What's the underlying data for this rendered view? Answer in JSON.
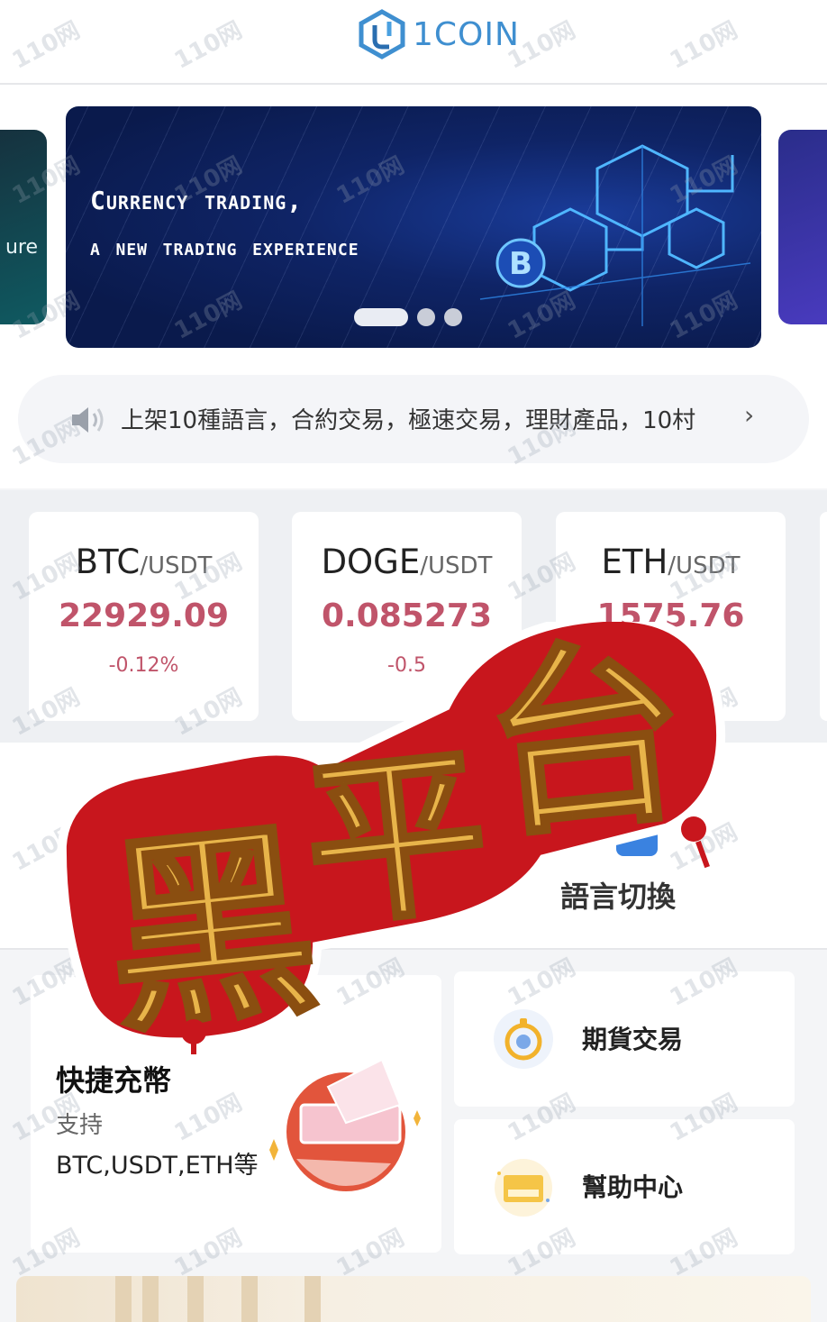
{
  "header": {
    "logo_text": "1COIN"
  },
  "banner": {
    "line1": "Currency trading,",
    "line2": "a new trading experience",
    "side_left_text": "ure",
    "coin_symbol": "B",
    "slide_count": 3,
    "active_slide": 1
  },
  "notice": {
    "icon": "speaker-icon",
    "text": "上架10種語言，合約交易，極速交易，理財產品，10村",
    "chevron": "›"
  },
  "tickers": [
    {
      "base": "BTC",
      "quote": "/USDT",
      "price": "22929.09",
      "change": "-0.12%"
    },
    {
      "base": "DOGE",
      "quote": "/USDT",
      "price": "0.085273",
      "change": "-0.5"
    },
    {
      "base": "ETH",
      "quote": "/USDT",
      "price": "1575.76",
      "change": "%"
    }
  ],
  "menu": {
    "language_switch": "語言切換",
    "language_icon": "language-icon"
  },
  "quick_deposit": {
    "title": "快捷充幣",
    "subtitle": "支持",
    "coins": "BTC,USDT,ETH等"
  },
  "side_items": [
    {
      "label": "期貨交易",
      "icon": "stopwatch-icon"
    },
    {
      "label": "幫助中心",
      "icon": "help-center-icon"
    }
  ],
  "overlay": {
    "stamp_text": "黑平台"
  },
  "watermark": {
    "text": "110网"
  },
  "colors": {
    "price_red": "#c0546a",
    "logo_blue": "#3f8fd0",
    "stamp_red": "#c8161d",
    "stamp_gold": "#e8b44a"
  }
}
